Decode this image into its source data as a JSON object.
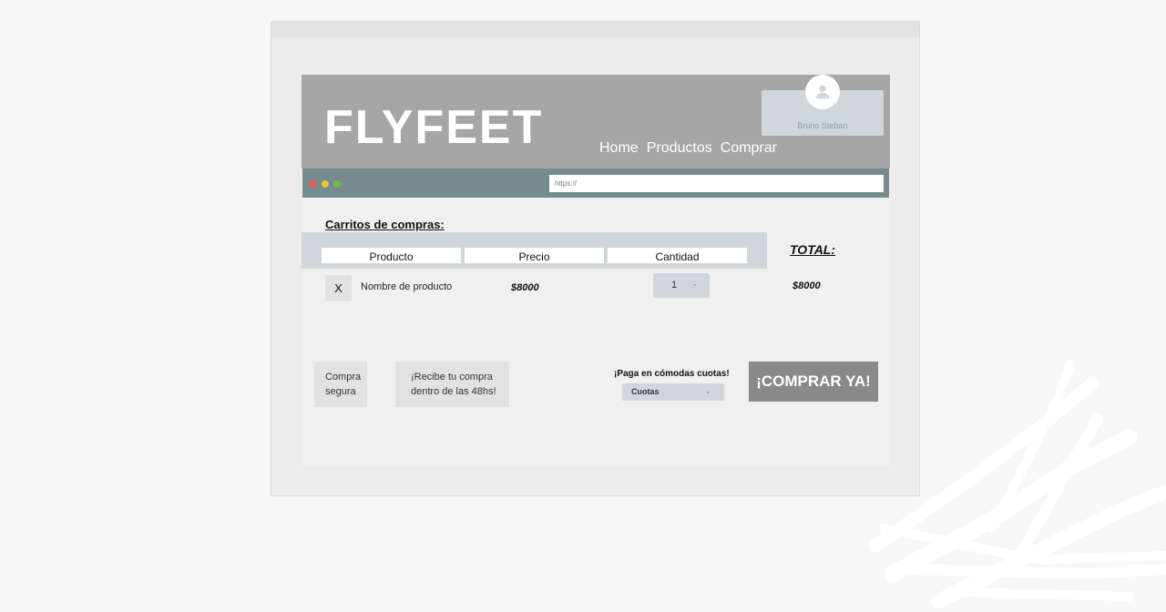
{
  "header": {
    "logo": "FLYFEET",
    "nav": [
      {
        "label": "Home"
      },
      {
        "label": "Productos"
      },
      {
        "label": "Comprar"
      }
    ],
    "user": {
      "name": "Bruno Steban",
      "icon": "user-avatar-icon"
    }
  },
  "browser": {
    "url_placeholder": "https://",
    "dots": [
      "#e85a5a",
      "#eac435",
      "#6cc04a"
    ]
  },
  "cart": {
    "title": "Carritos de compras:",
    "columns": [
      "Producto",
      "Precio",
      "Cantidad"
    ],
    "total_label": "TOTAL:",
    "items": [
      {
        "remove_label": "X",
        "name": "Nombre de producto",
        "price": "$8000",
        "quantity": "1"
      }
    ],
    "total_value": "$8000"
  },
  "footer": {
    "secure_line1": "Compra",
    "secure_line2": "segura",
    "delivery_line1": "¡Recibe tu compra",
    "delivery_line2": "dentro de las 48hs!",
    "installments_label": "¡Paga en cómodas cuotas!",
    "installments_select": "Cuotas",
    "buy_button": "¡COMPRAR YA!"
  },
  "colors": {
    "header_bg": "#a6a6a7",
    "browserbar_bg": "#778a8f",
    "accent_light": "#cfd6dc",
    "buy_button_bg": "#898989"
  }
}
